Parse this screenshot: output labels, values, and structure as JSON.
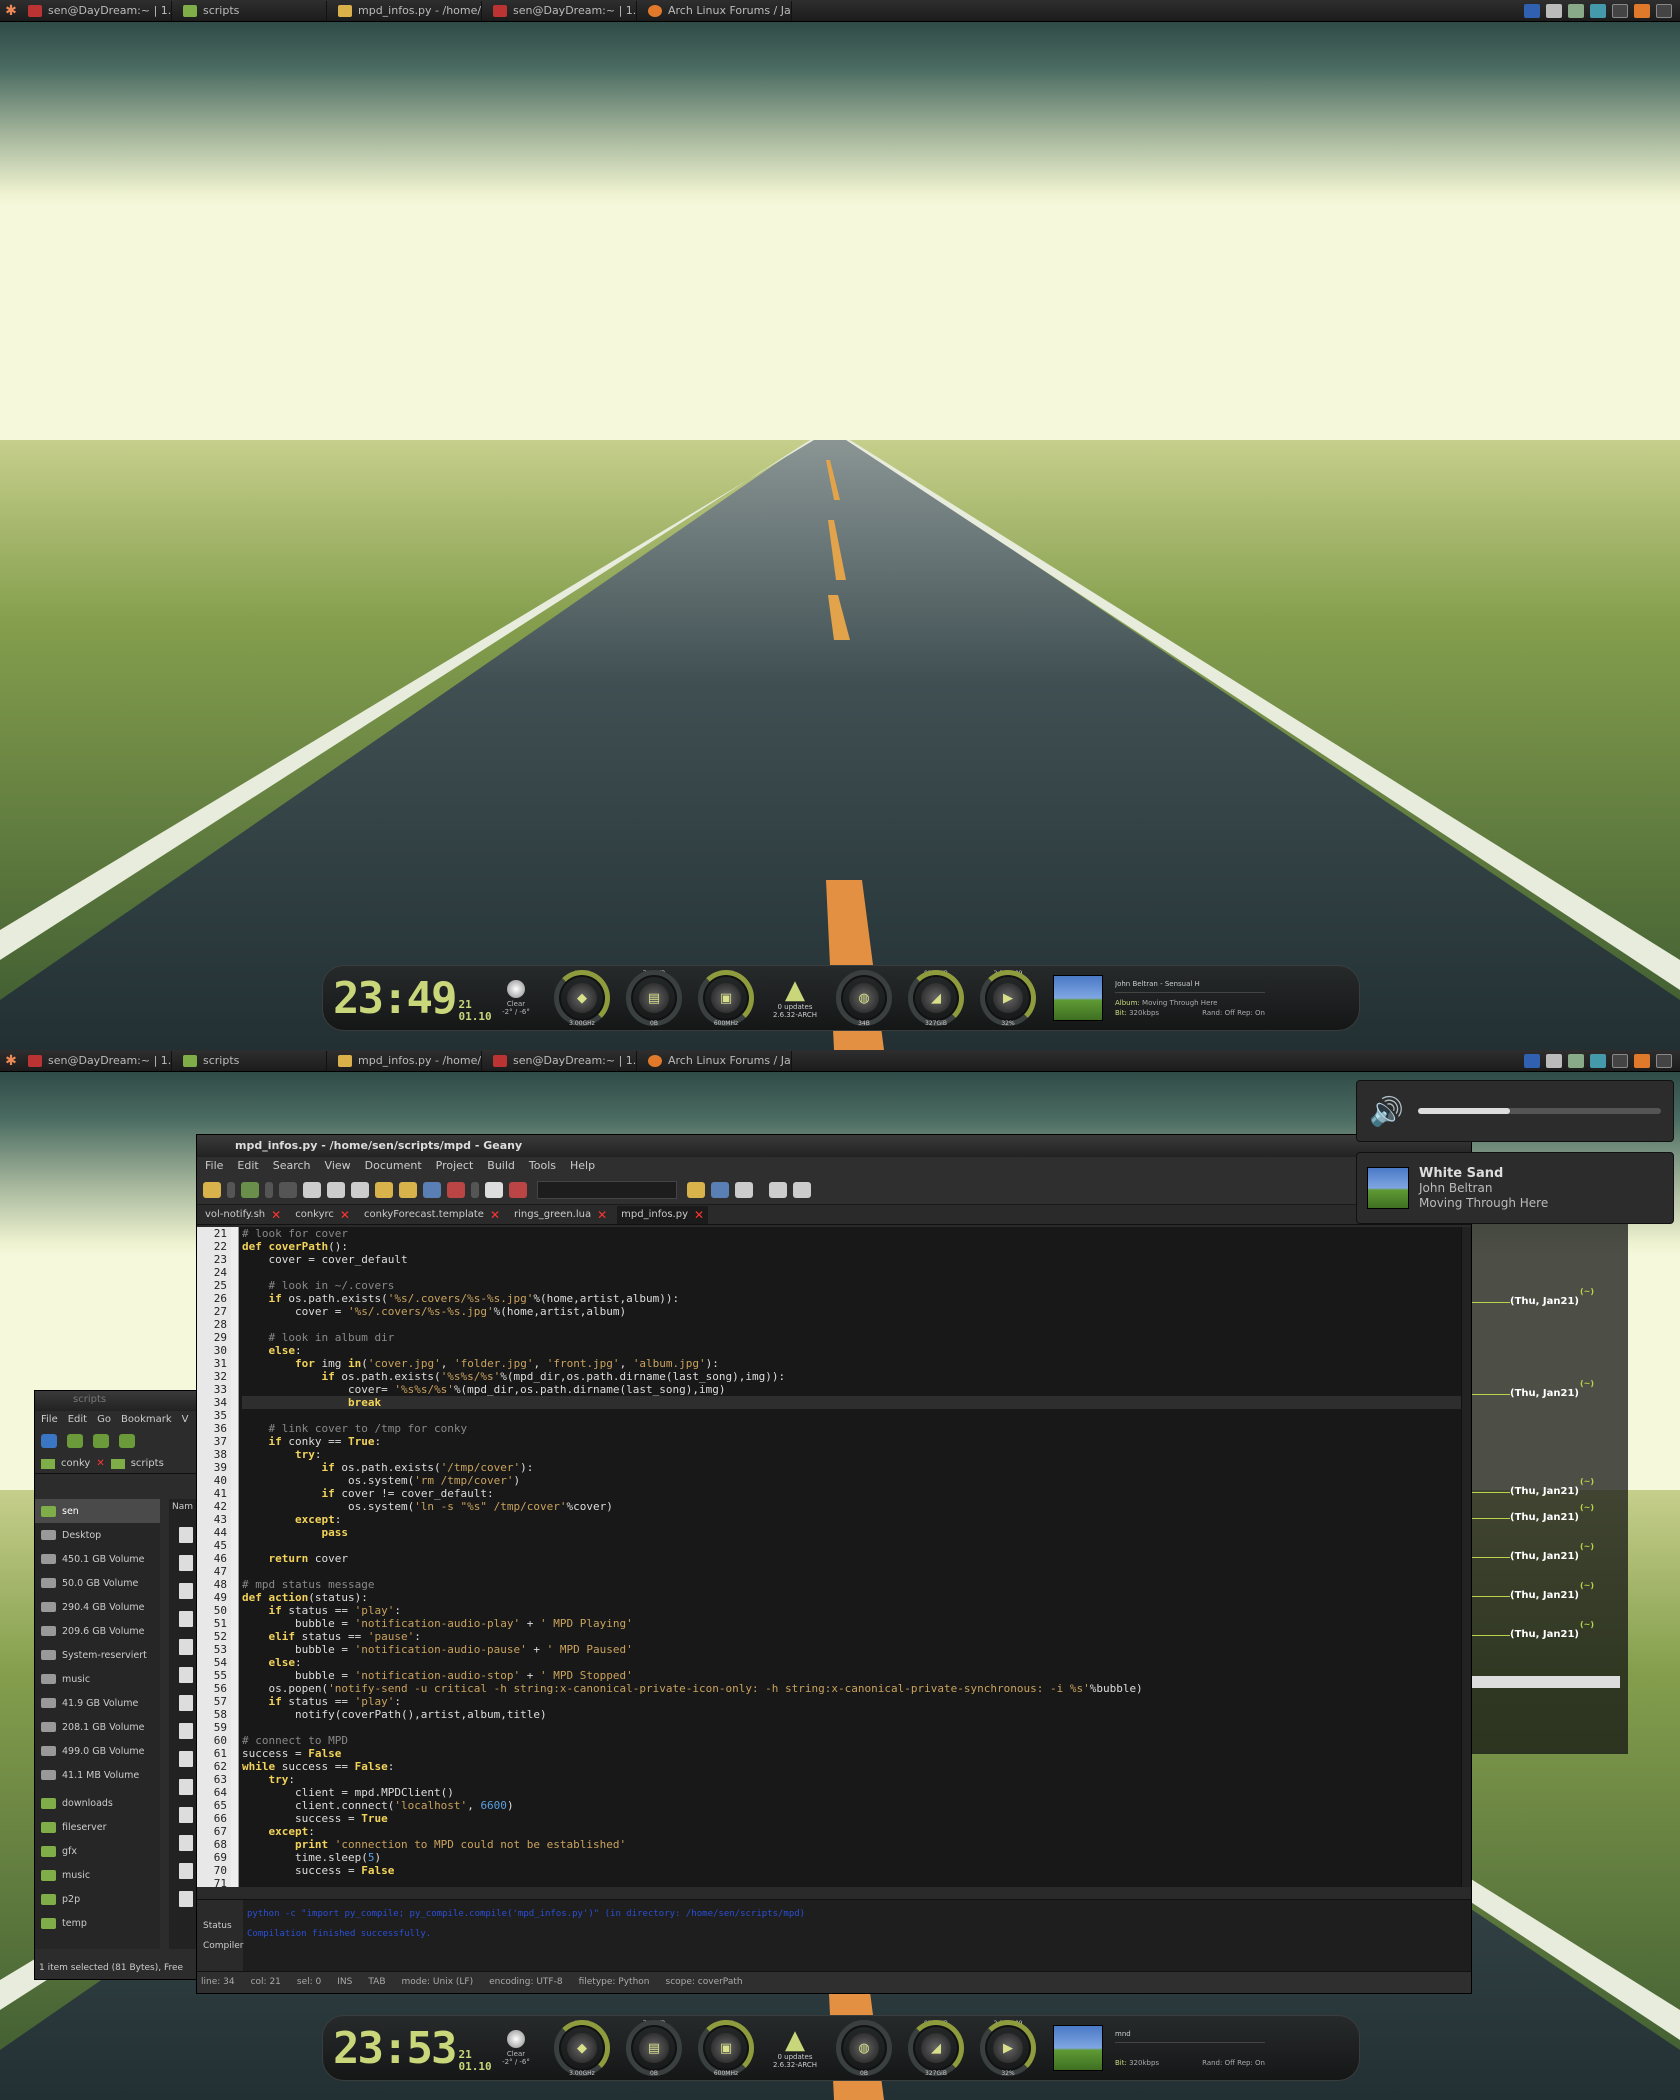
{
  "taskbar": {
    "tasks": [
      "sen@DayDream:~ | 1...",
      "scripts",
      "mpd_infos.py - /home/...",
      "sen@DayDream:~ | 1...",
      "Arch Linux Forums / Ja..."
    ]
  },
  "dock_top": {
    "clock_time": "23:49",
    "clock_sec": "21",
    "clock_date": "01.10",
    "weather_label": "Clear",
    "weather_temp": "-2° / -6°",
    "gauges": [
      {
        "top": "37°C",
        "bottom": "3.00GHz"
      },
      {
        "top": "701MiB",
        "bottom": "0B"
      },
      {
        "top": "44°C",
        "bottom": "600MHz"
      },
      {
        "top": "67B",
        "bottom": "34B"
      },
      {
        "top": "93.5GiB",
        "bottom": "327GiB"
      },
      {
        "top": "2:51/4:09",
        "bottom": "32%"
      }
    ],
    "arch_updates": "0 updates",
    "arch_kernel": "2.6.32-ARCH",
    "np_title": "John Beltran - Sensual H",
    "np_album_label": "Album:",
    "np_album": "Moving Through Here",
    "np_bit_label": "Bit:",
    "np_bit": "320kbps",
    "np_rand": "Rand: Off",
    "np_rep": "Rep: On"
  },
  "dock_bottom": {
    "clock_time": "23:53",
    "clock_sec": "21",
    "clock_date": "01.10",
    "weather_label": "Clear",
    "weather_temp": "-2° / -6°",
    "gauges": [
      {
        "top": "35°C",
        "bottom": "3.00GHz"
      },
      {
        "top": "706MiB",
        "bottom": "0B"
      },
      {
        "top": "44°C",
        "bottom": "600MHz"
      },
      {
        "top": "0B",
        "bottom": "0B"
      },
      {
        "top": "93.5GiB",
        "bottom": "327GiB"
      },
      {
        "top": "2:26/4:09",
        "bottom": "32%"
      }
    ],
    "arch_updates": "0 updates",
    "arch_kernel": "2.6.32-ARCH",
    "np_title": "mnd",
    "np_bit_label": "Bit:",
    "np_bit": "320kbps",
    "np_rand": "Rand: Off",
    "np_rep": "Rep: On"
  },
  "geany": {
    "title": "mpd_infos.py - /home/sen/scripts/mpd - Geany",
    "menu": [
      "File",
      "Edit",
      "Search",
      "View",
      "Document",
      "Project",
      "Build",
      "Tools",
      "Help"
    ],
    "tabs": [
      "vol-notify.sh",
      "conkyrc",
      "conkyForecast.template",
      "rings_green.lua",
      "mpd_infos.py"
    ],
    "first_line": 21,
    "msg_tabs": [
      "Status",
      "Compiler"
    ],
    "msg_lines": [
      "python -c \"import py_compile; py_compile.compile('mpd_infos.py')\" (in directory: /home/sen/scripts/mpd)",
      "Compilation finished successfully."
    ],
    "status": [
      "line: 34",
      "col: 21",
      "sel: 0",
      "INS",
      "TAB",
      "mode: Unix (LF)",
      "encoding: UTF-8",
      "filetype: Python",
      "scope: coverPath"
    ]
  },
  "code": [
    [
      [
        "cm",
        "# look for cover"
      ]
    ],
    [
      [
        "kw",
        "def "
      ],
      [
        "fn",
        "coverPath"
      ],
      [
        "",
        "():"
      ]
    ],
    [
      [
        "",
        "    cover = cover_default"
      ]
    ],
    [
      [
        "",
        ""
      ]
    ],
    [
      [
        "cm",
        "    # look in ~/.covers"
      ]
    ],
    [
      [
        "kw",
        "    if "
      ],
      [
        "",
        "os.path.exists("
      ],
      [
        "st",
        "'%s/.covers/%s-%s.jpg'"
      ],
      [
        "",
        "%(home,artist,album)):"
      ]
    ],
    [
      [
        "",
        "        cover = "
      ],
      [
        "st",
        "'%s/.covers/%s-%s.jpg'"
      ],
      [
        "",
        "%(home,artist,album)"
      ]
    ],
    [
      [
        "",
        ""
      ]
    ],
    [
      [
        "cm",
        "    # look in album dir"
      ]
    ],
    [
      [
        "kw",
        "    else"
      ],
      [
        "",
        ":"
      ]
    ],
    [
      [
        "kw",
        "        for "
      ],
      [
        "",
        "img "
      ],
      [
        "kw",
        "in"
      ],
      [
        "",
        "("
      ],
      [
        "st",
        "'cover.jpg'"
      ],
      [
        "",
        ", "
      ],
      [
        "st",
        "'folder.jpg'"
      ],
      [
        "",
        ", "
      ],
      [
        "st",
        "'front.jpg'"
      ],
      [
        "",
        ", "
      ],
      [
        "st",
        "'album.jpg'"
      ],
      [
        "",
        "):"
      ]
    ],
    [
      [
        "kw",
        "            if "
      ],
      [
        "",
        "os.path.exists("
      ],
      [
        "st",
        "'%s%s/%s'"
      ],
      [
        "",
        "%(mpd_dir,os.path.dirname(last_song),img)):"
      ]
    ],
    [
      [
        "",
        "                cover= "
      ],
      [
        "st",
        "'%s%s/%s'"
      ],
      [
        "",
        "%(mpd_dir,os.path.dirname(last_song),img)"
      ]
    ],
    [
      [
        "kw",
        "                break"
      ]
    ],
    [
      [
        "",
        ""
      ]
    ],
    [
      [
        "cm",
        "    # link cover to /tmp for conky"
      ]
    ],
    [
      [
        "kw",
        "    if "
      ],
      [
        "",
        "conky == "
      ],
      [
        "kw",
        "True"
      ],
      [
        "",
        ":"
      ]
    ],
    [
      [
        "kw",
        "        try"
      ],
      [
        "",
        ":"
      ]
    ],
    [
      [
        "kw",
        "            if "
      ],
      [
        "",
        "os.path.exists("
      ],
      [
        "st",
        "'/tmp/cover'"
      ],
      [
        "",
        "):"
      ]
    ],
    [
      [
        "",
        "                os.system("
      ],
      [
        "st",
        "'rm /tmp/cover'"
      ],
      [
        "",
        ")"
      ]
    ],
    [
      [
        "kw",
        "            if "
      ],
      [
        "",
        "cover != cover_default:"
      ]
    ],
    [
      [
        "",
        "                os.system("
      ],
      [
        "st",
        "'ln -s \"%s\" /tmp/cover'"
      ],
      [
        "",
        "%cover)"
      ]
    ],
    [
      [
        "kw",
        "        except"
      ],
      [
        "",
        ":"
      ]
    ],
    [
      [
        "kw",
        "            pass"
      ]
    ],
    [
      [
        "",
        ""
      ]
    ],
    [
      [
        "kw",
        "    return "
      ],
      [
        "",
        "cover"
      ]
    ],
    [
      [
        "",
        ""
      ]
    ],
    [
      [
        "cm",
        "# mpd status message"
      ]
    ],
    [
      [
        "kw",
        "def "
      ],
      [
        "fn",
        "action"
      ],
      [
        "",
        "(status):"
      ]
    ],
    [
      [
        "kw",
        "    if "
      ],
      [
        "",
        "status == "
      ],
      [
        "st",
        "'play'"
      ],
      [
        "",
        ":"
      ]
    ],
    [
      [
        "",
        "        bubble = "
      ],
      [
        "st",
        "'notification-audio-play'"
      ],
      [
        "",
        " + "
      ],
      [
        "st",
        "' MPD Playing'"
      ]
    ],
    [
      [
        "kw",
        "    elif "
      ],
      [
        "",
        "status == "
      ],
      [
        "st",
        "'pause'"
      ],
      [
        "",
        ":"
      ]
    ],
    [
      [
        "",
        "        bubble = "
      ],
      [
        "st",
        "'notification-audio-pause'"
      ],
      [
        "",
        " + "
      ],
      [
        "st",
        "' MPD Paused'"
      ]
    ],
    [
      [
        "kw",
        "    else"
      ],
      [
        "",
        ":"
      ]
    ],
    [
      [
        "",
        "        bubble = "
      ],
      [
        "st",
        "'notification-audio-stop'"
      ],
      [
        "",
        " + "
      ],
      [
        "st",
        "' MPD Stopped'"
      ]
    ],
    [
      [
        "",
        "    os.popen("
      ],
      [
        "st",
        "'notify-send -u critical -h string:x-canonical-private-icon-only: -h string:x-canonical-private-synchronous: -i %s'"
      ],
      [
        "",
        "%bubble)"
      ]
    ],
    [
      [
        "kw",
        "    if "
      ],
      [
        "",
        "status == "
      ],
      [
        "st",
        "'play'"
      ],
      [
        "",
        ":"
      ]
    ],
    [
      [
        "",
        "        notify(coverPath(),artist,album,title)"
      ]
    ],
    [
      [
        "",
        ""
      ]
    ],
    [
      [
        "cm",
        "# connect to MPD"
      ]
    ],
    [
      [
        "",
        "success = "
      ],
      [
        "kw",
        "False"
      ]
    ],
    [
      [
        "kw",
        "while "
      ],
      [
        "",
        "success == "
      ],
      [
        "kw",
        "False"
      ],
      [
        "",
        ":"
      ]
    ],
    [
      [
        "kw",
        "    try"
      ],
      [
        "",
        ":"
      ]
    ],
    [
      [
        "",
        "        client = mpd.MPDClient()"
      ]
    ],
    [
      [
        "",
        "        client.connect("
      ],
      [
        "st",
        "'localhost'"
      ],
      [
        "",
        ", "
      ],
      [
        "nm",
        "6600"
      ],
      [
        "",
        ")"
      ]
    ],
    [
      [
        "",
        "        success = "
      ],
      [
        "kw",
        "True"
      ]
    ],
    [
      [
        "kw",
        "    except"
      ],
      [
        "",
        ":"
      ]
    ],
    [
      [
        "kw",
        "        print "
      ],
      [
        "st",
        "'connection to MPD could not be established'"
      ]
    ],
    [
      [
        "",
        "        time.sleep("
      ],
      [
        "nm",
        "5"
      ],
      [
        "",
        ")"
      ]
    ],
    [
      [
        "",
        "        success = "
      ],
      [
        "kw",
        "False"
      ]
    ],
    [
      [
        "",
        ""
      ]
    ]
  ],
  "thunar": {
    "title": "scripts",
    "menu": [
      "File",
      "Edit",
      "Go",
      "Bookmark",
      "V"
    ],
    "tabs": [
      "conky",
      "scripts"
    ],
    "places": [
      "sen",
      "Desktop",
      "450.1 GB Volume",
      "50.0 GB Volume",
      "290.4 GB Volume",
      "209.6 GB Volume",
      "System-reserviert",
      "music",
      "41.9 GB Volume",
      "208.1 GB Volume",
      "499.0 GB Volume",
      "41.1 MB Volume",
      "downloads",
      "fileserver",
      "gfx",
      "music",
      "p2p",
      "temp"
    ],
    "list_header": "Nam",
    "status": "1 item selected (81 Bytes), Free"
  },
  "calendar": {
    "entries": [
      "(Thu, Jan21)",
      "(Thu, Jan21)",
      "(Thu, Jan21)",
      "(Thu, Jan21)",
      "(Thu, Jan21)",
      "(Thu, Jan21)",
      "(Thu, Jan21)"
    ],
    "tick": "(~)"
  },
  "notifications": {
    "volume_level": 0.38,
    "song": "White Sand",
    "artist": "John Beltran",
    "album": "Moving Through Here"
  }
}
